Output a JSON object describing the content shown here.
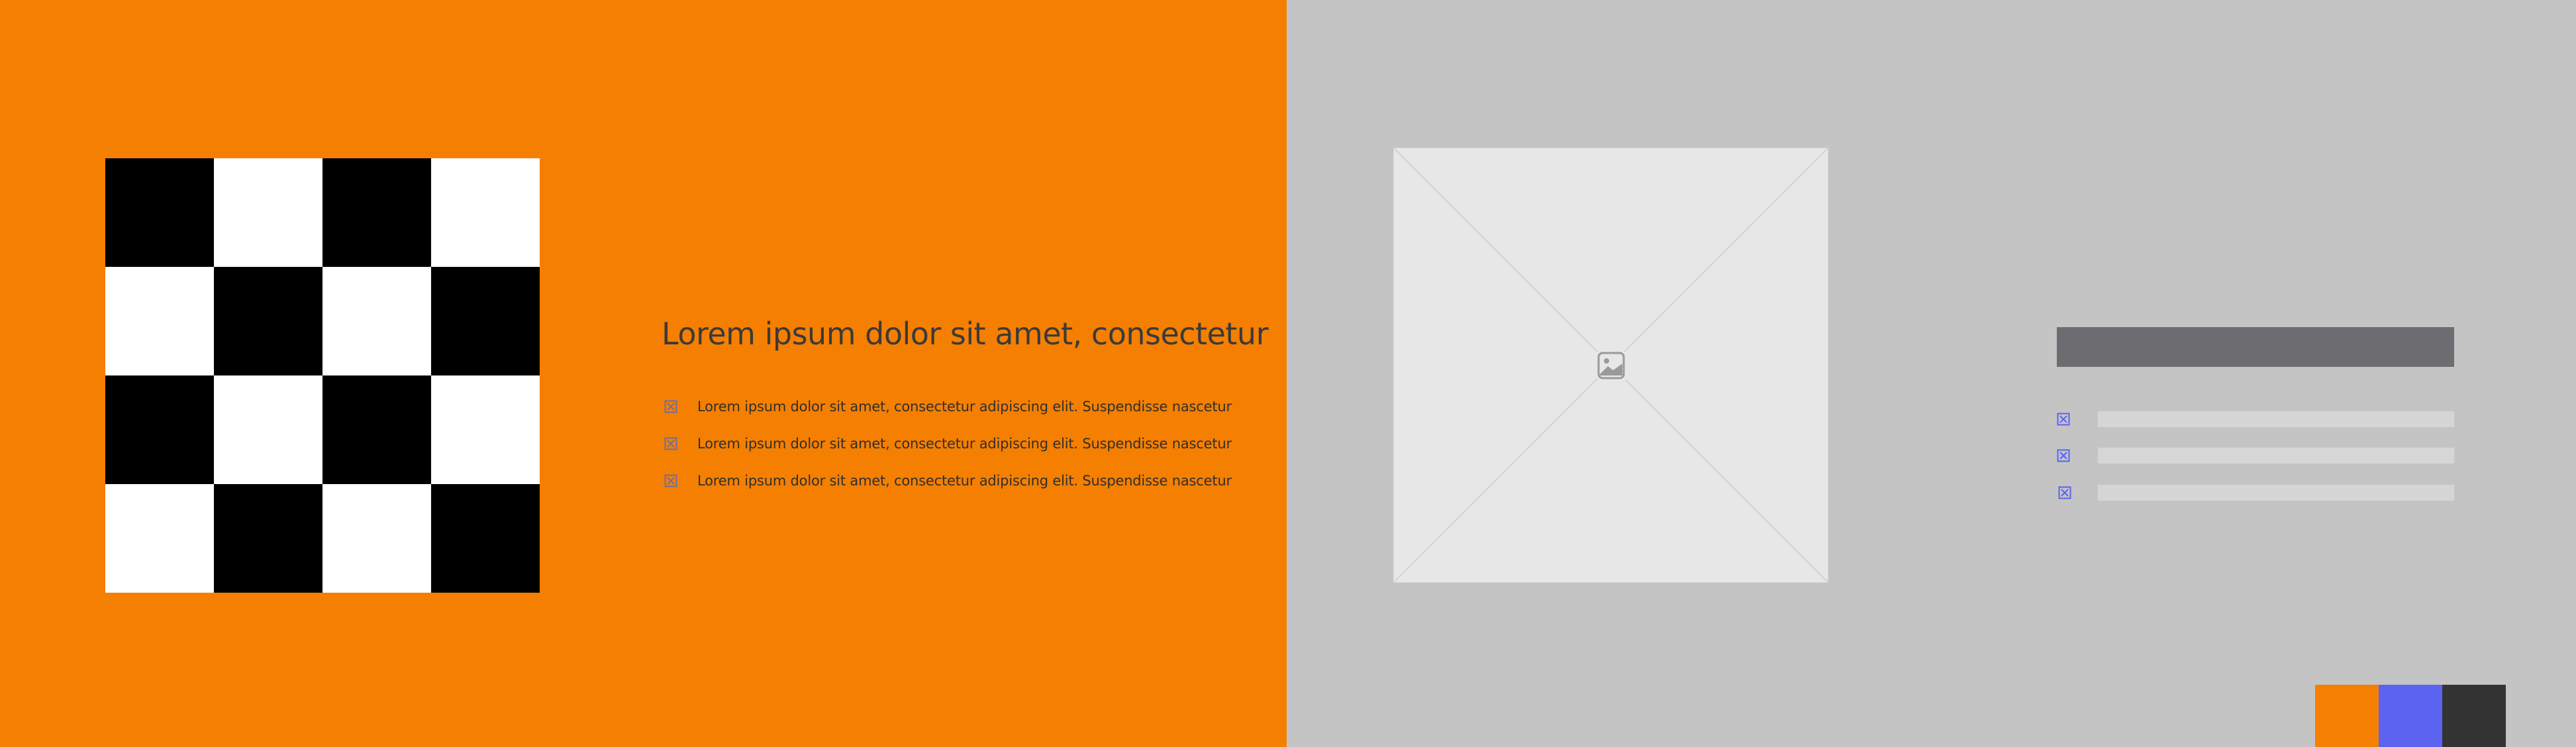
{
  "left_panel": {
    "background": "#f57f00",
    "checkerboard": {
      "colors": [
        "#000000",
        "#ffffff"
      ],
      "rows": 4,
      "cols": 4
    },
    "heading": "Lorem ipsum dolor sit amet, consectetur",
    "bullets": [
      {
        "icon": "checkbox-x-icon",
        "text": "Lorem ipsum dolor sit amet, consectetur adipiscing elit. Suspendisse nascetur"
      },
      {
        "icon": "checkbox-x-icon",
        "text": "Lorem ipsum dolor sit amet, consectetur adipiscing elit. Suspendisse nascetur"
      },
      {
        "icon": "checkbox-x-icon",
        "text": "Lorem ipsum dolor sit amet, consectetur adipiscing elit. Suspendisse nascetur"
      }
    ]
  },
  "right_panel": {
    "background": "#c4c4c4",
    "image_placeholder": {
      "icon": "image-icon",
      "fill": "#e7e7e7"
    },
    "wireframe": {
      "title_bar_color": "#6d6c70",
      "line_color": "#d6d6d6",
      "checkbox_color": "#5b63f0",
      "rows": 3
    }
  },
  "palette": {
    "swatches": [
      "#f57f00",
      "#5b63f0",
      "#333333"
    ]
  }
}
